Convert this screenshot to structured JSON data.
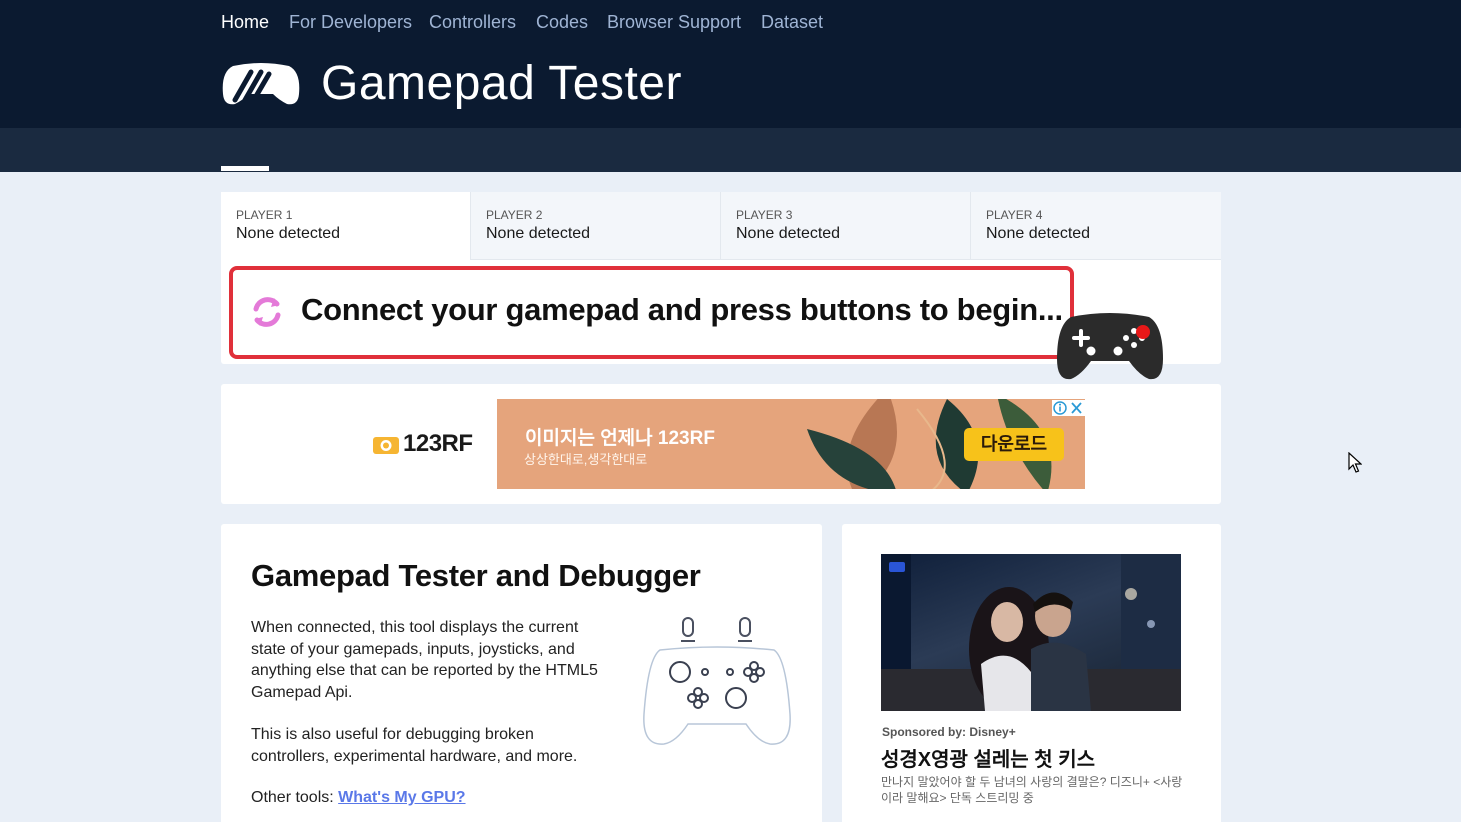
{
  "header": {
    "site_title": "Gamepad Tester",
    "logo_icon": "gamepad-logo-icon"
  },
  "nav": {
    "items": [
      {
        "label": "Home",
        "active": true
      },
      {
        "label": "For Developers",
        "active": false
      },
      {
        "label": "Controllers",
        "active": false
      },
      {
        "label": "Codes",
        "active": false
      },
      {
        "label": "Browser Support",
        "active": false
      },
      {
        "label": "Dataset",
        "active": false
      }
    ]
  },
  "players": [
    {
      "label": "PLAYER 1",
      "status": "None detected"
    },
    {
      "label": "PLAYER 2",
      "status": "None detected"
    },
    {
      "label": "PLAYER 3",
      "status": "None detected"
    },
    {
      "label": "PLAYER 4",
      "status": "None detected"
    }
  ],
  "connect": {
    "message": "Connect your gamepad and press buttons to begin...",
    "icon": "refresh-icon",
    "accent_color": "#e0303a"
  },
  "ad": {
    "brand": "123RF",
    "title": "이미지는 언제나 123RF",
    "subtitle": "상상한대로,생각한대로",
    "button": "다운로드"
  },
  "about": {
    "title": "Gamepad Tester and Debugger",
    "p1": "When connected, this tool displays the current state of your gamepads, inputs, joysticks, and anything else that can be reported by the HTML5 Gamepad Api.",
    "p2": "This is also useful for debugging broken controllers, experimental hardware, and more.",
    "other_label": "Other tools:",
    "other_link": "What's My GPU?"
  },
  "sponsor": {
    "by": "Sponsored by: Disney+",
    "title": "성경X영광 설레는 첫 키스",
    "desc": "만나지 말았어야 할 두 남녀의 사랑의 결말은? 디즈니+ <사랑이라 말해요> 단독 스트리밍 중"
  },
  "colors": {
    "header_bg": "#0b1a30",
    "nav_bg": "#1a2a40",
    "page_bg": "#e9eff7",
    "link": "#5a78e8"
  }
}
